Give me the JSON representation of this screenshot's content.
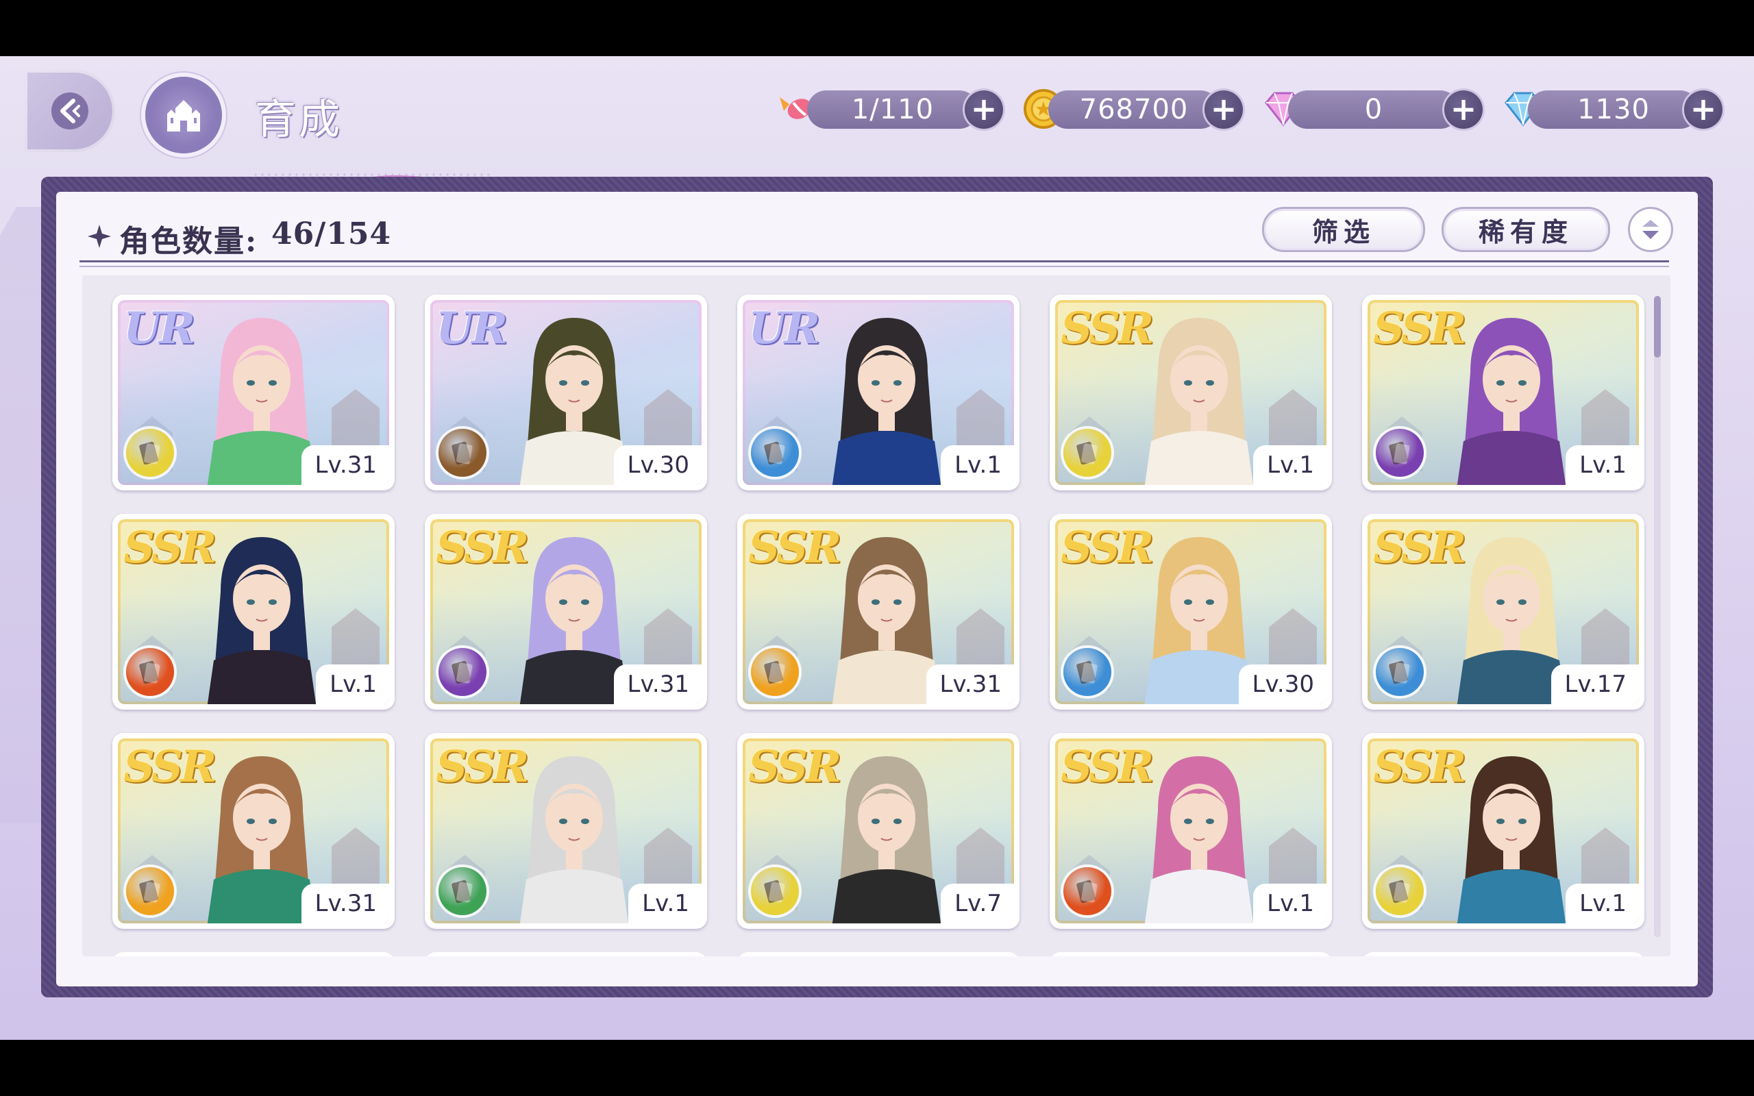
{
  "header": {
    "title": "育成",
    "resources": [
      {
        "name": "candy",
        "value": "1/110",
        "icon": "candy-icon"
      },
      {
        "name": "gold",
        "value": "768700",
        "icon": "gold-coin-icon"
      },
      {
        "name": "pink-gem",
        "value": "0",
        "icon": "pink-diamond-icon"
      },
      {
        "name": "blue-gem",
        "value": "1130",
        "icon": "blue-diamond-icon"
      }
    ]
  },
  "panel": {
    "count_label": "角色数量:",
    "count_value": "46/154",
    "filter_label": "筛选",
    "rarity_label": "稀有度"
  },
  "cards": [
    {
      "rarity": "UR",
      "level": "Lv.31",
      "class_color": "#e8d23a",
      "class": "card-icon",
      "hair": "#f3b7d6",
      "outfit": "#5bbf7a"
    },
    {
      "rarity": "UR",
      "level": "Lv.30",
      "class_color": "#8b5a2b",
      "class": "shield-icon",
      "hair": "#4a4a2a",
      "outfit": "#f2efe6"
    },
    {
      "rarity": "UR",
      "level": "Lv.1",
      "class_color": "#3d8ed6",
      "class": "shield-icon",
      "hair": "#2e2a2e",
      "outfit": "#1f3f8c"
    },
    {
      "rarity": "SSR",
      "level": "Lv.1",
      "class_color": "#e8d23a",
      "class": "scepter-icon",
      "hair": "#e8d2b0",
      "outfit": "#f6efe6"
    },
    {
      "rarity": "SSR",
      "level": "Lv.1",
      "class_color": "#7a3fb0",
      "class": "cards-icon",
      "hair": "#8d52b8",
      "outfit": "#6a3a8e"
    },
    {
      "rarity": "SSR",
      "level": "Lv.1",
      "class_color": "#e0501e",
      "class": "cards-icon",
      "hair": "#1f2c55",
      "outfit": "#2a2230"
    },
    {
      "rarity": "SSR",
      "level": "Lv.31",
      "class_color": "#7a3fb0",
      "class": "fist-icon",
      "hair": "#b3a6e6",
      "outfit": "#2b2b34"
    },
    {
      "rarity": "SSR",
      "level": "Lv.31",
      "class_color": "#f0a21e",
      "class": "cards-icon",
      "hair": "#8a6a4a",
      "outfit": "#f2e6d2"
    },
    {
      "rarity": "SSR",
      "level": "Lv.30",
      "class_color": "#3d8ed6",
      "class": "scepter-icon",
      "hair": "#e8c27a",
      "outfit": "#b8d4ef"
    },
    {
      "rarity": "SSR",
      "level": "Lv.17",
      "class_color": "#3d8ed6",
      "class": "cards-icon",
      "hair": "#f1e2b2",
      "outfit": "#2f5f7a"
    },
    {
      "rarity": "SSR",
      "level": "Lv.31",
      "class_color": "#f0a21e",
      "class": "cards-icon",
      "hair": "#a5714a",
      "outfit": "#2d8f6f"
    },
    {
      "rarity": "SSR",
      "level": "Lv.1",
      "class_color": "#3fa356",
      "class": "scepter-icon",
      "hair": "#d8d8d8",
      "outfit": "#e9e9e9"
    },
    {
      "rarity": "SSR",
      "level": "Lv.7",
      "class_color": "#e8d23a",
      "class": "cards-icon",
      "hair": "#b9ae9a",
      "outfit": "#2a2a2a"
    },
    {
      "rarity": "SSR",
      "level": "Lv.1",
      "class_color": "#e0501e",
      "class": "boot-icon",
      "hair": "#d36fa6",
      "outfit": "#f2f2f6"
    },
    {
      "rarity": "SSR",
      "level": "Lv.1",
      "class_color": "#e8d23a",
      "class": "cards-icon",
      "hair": "#4a2f22",
      "outfit": "#2f7fa6"
    }
  ]
}
